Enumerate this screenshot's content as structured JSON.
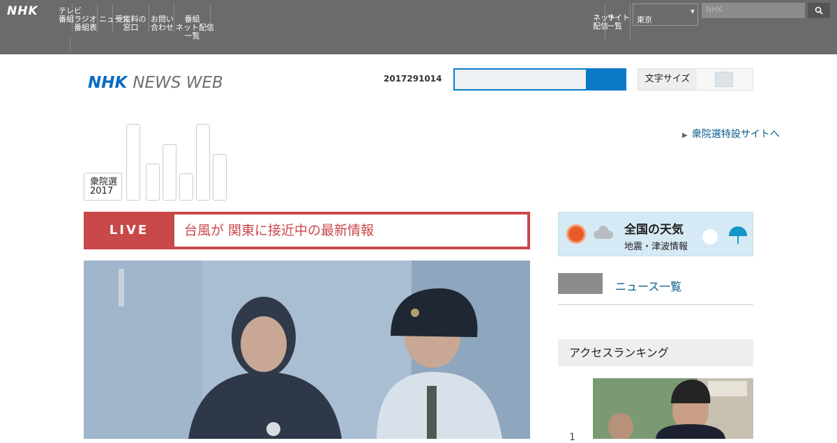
{
  "topbar": {
    "logo": "NHK",
    "nav": [
      {
        "label": "テレビ\n番組"
      },
      {
        "label": "\nラジオ\n番組表"
      },
      {
        "label": "\nニュース"
      },
      {
        "label": "\n受信料の\n窓口"
      },
      {
        "label": "\nお問い\n合わせ"
      },
      {
        "label": "\n番組\nネット配信\n一覧"
      }
    ],
    "right": [
      {
        "label": "\nネット\n配信"
      },
      {
        "label": "\nサイト\n一覧"
      }
    ],
    "region": "東京",
    "search_placeholder": "NHK",
    "search_icon": "magnifier-icon"
  },
  "header": {
    "brand_1": "NHK",
    "brand_2": "NEWS WEB",
    "date": "2017291014",
    "toggle_label": "文字サイズ"
  },
  "election": {
    "badge": "衆院選\n2017",
    "bar_levels": [
      1.0,
      0.48,
      0.74,
      0.35,
      1.0,
      0.61
    ],
    "link": "衆院選特設サイトへ"
  },
  "live": {
    "tag": "LIVE",
    "headline": "台風が 関東に接近中の最新情報"
  },
  "sidebar": {
    "weather_title": "全国の天気",
    "weather_sub": "地震・津波情報",
    "nav_link": "ニュース一覧",
    "ranking_title": "アクセスランキング",
    "ranking_first": "1"
  },
  "colors": {
    "topbar": "#6b6b6b",
    "brand_blue": "#0a6cc2",
    "live_red": "#c9484a",
    "link": "#0a5c8c"
  }
}
